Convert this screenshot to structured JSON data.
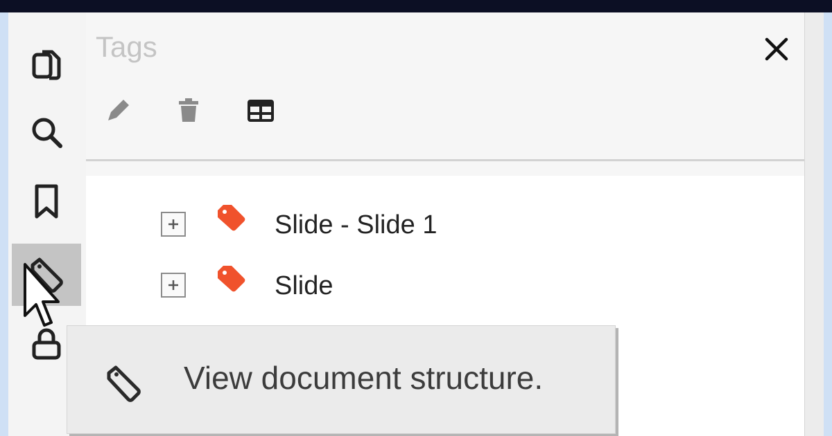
{
  "panel": {
    "title": "Tags",
    "toolbar": {
      "close_icon": "close-icon",
      "edit_icon": "pencil-icon",
      "delete_icon": "trash-icon",
      "table_icon": "table-icon"
    }
  },
  "left_rail": {
    "items": [
      {
        "icon": "pages-icon"
      },
      {
        "icon": "search-icon"
      },
      {
        "icon": "bookmark-icon"
      },
      {
        "icon": "tag-icon",
        "active": true
      },
      {
        "icon": "lock-icon"
      }
    ]
  },
  "tree": {
    "items": [
      {
        "label": "Slide - Slide 1",
        "icon": "tag-icon"
      },
      {
        "label": "Slide",
        "icon": "tag-icon"
      }
    ]
  },
  "tooltip": {
    "text": "View document structure.",
    "icon": "tag-icon"
  },
  "colors": {
    "tag_orange": "#f0522c",
    "active_rail": "#c4c4c4",
    "topbar": "#0c0f24"
  }
}
